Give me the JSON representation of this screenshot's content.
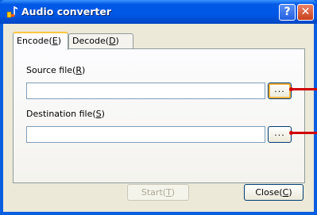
{
  "window": {
    "title": "Audio converter"
  },
  "titlebar": {
    "help_glyph": "?",
    "close_glyph": "✕"
  },
  "tabs": [
    {
      "label": "Encode(",
      "mnemonic": "E",
      "suffix": ")"
    },
    {
      "label": "Decode(",
      "mnemonic": "D",
      "suffix": ")"
    }
  ],
  "encode": {
    "source": {
      "label": "Source file(",
      "mnemonic": "R",
      "suffix": ")",
      "value": ""
    },
    "destination": {
      "label": "Destination file(",
      "mnemonic": "S",
      "suffix": ")",
      "value": ""
    },
    "browse_label": "..."
  },
  "buttons": {
    "start": {
      "label": "Start(",
      "mnemonic": "T",
      "suffix": ")"
    },
    "close": {
      "label": "Close(",
      "mnemonic": "C",
      "suffix": ")"
    }
  },
  "colors": {
    "titlebar": "#0058e6",
    "panel": "#ece9d8",
    "pointer": "#d10000"
  }
}
